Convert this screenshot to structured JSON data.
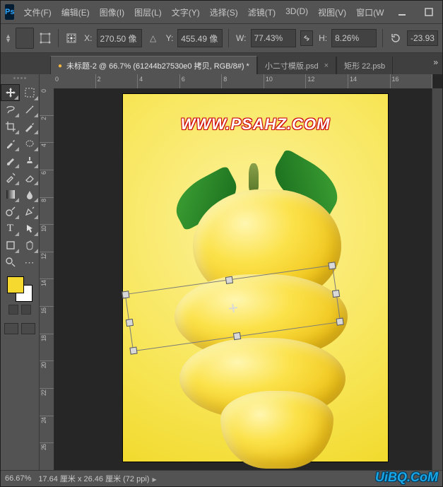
{
  "menu": {
    "file": "文件(F)",
    "edit": "编辑(E)",
    "image": "图像(I)",
    "layer": "图层(L)",
    "type": "文字(Y)",
    "select": "选择(S)",
    "filter": "滤镜(T)",
    "threeD": "3D(D)",
    "view": "视图(V)",
    "window": "窗口(W"
  },
  "options": {
    "x_label": "X:",
    "x_value": "270.50 像⁠",
    "y_label": "Y:",
    "y_value": "455.49 像⁠",
    "w_label": "W:",
    "w_value": "77.43%",
    "h_label": "H:",
    "h_value": "8.26%",
    "angle_value": "-23.93"
  },
  "tabs": {
    "active": "未标题-2 @ 66.7% (61244b27530e0 拷贝, RGB/8#) *",
    "second": "小二寸模版.psd",
    "third": "矩形 22.psb"
  },
  "ruler_h": [
    "0",
    "2",
    "4",
    "6",
    "8",
    "10",
    "12",
    "14",
    "16"
  ],
  "ruler_v": [
    "0",
    "2",
    "4",
    "6",
    "8",
    "10",
    "12",
    "14",
    "16",
    "18",
    "20",
    "22",
    "24",
    "26"
  ],
  "canvas": {
    "watermark": "WWW.PSAHZ.COM"
  },
  "status": {
    "zoom": "66.67%",
    "info": "17.64 厘米 x 26.46 厘米 (72 ppi)"
  },
  "brand": "UiBQ.CoM",
  "colors": {
    "fg": "#f6d92e",
    "bg": "#ffffff"
  }
}
